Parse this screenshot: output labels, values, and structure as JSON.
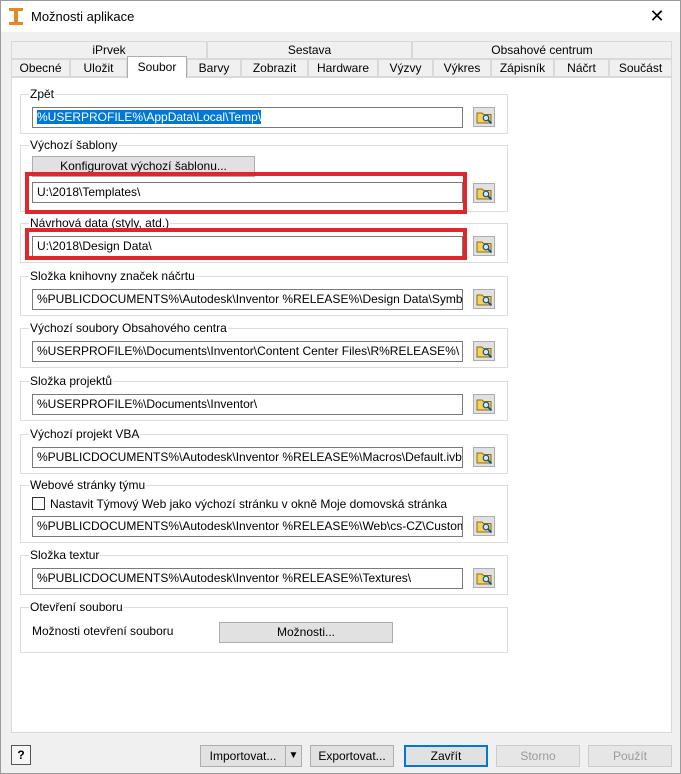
{
  "window": {
    "title": "Možnosti aplikace",
    "close": "✕"
  },
  "tabs": {
    "row1": [
      "iPrvek",
      "Sestava",
      "Obsahové centrum"
    ],
    "row2": [
      "Obecné",
      "Uložit",
      "Soubor",
      "Barvy",
      "Zobrazit",
      "Hardware",
      "Výzvy",
      "Výkres",
      "Zápisník",
      "Náčrt",
      "Součást"
    ],
    "active": "Soubor"
  },
  "groups": {
    "undo": {
      "label": "Zpět",
      "path": "%USERPROFILE%\\AppData\\Local\\Temp\\"
    },
    "templates": {
      "label": "Výchozí šablony",
      "config_button": "Konfigurovat výchozí šablonu...",
      "path": "U:\\2018\\Templates\\"
    },
    "design_data": {
      "label": "Návrhová data (styly, atd.)",
      "path": "U:\\2018\\Design Data\\"
    },
    "sketch_symbols": {
      "label": "Složka knihovny značek náčrtu",
      "path": "%PUBLICDOCUMENTS%\\Autodesk\\Inventor %RELEASE%\\Design Data\\Symbol Library\\"
    },
    "content_center": {
      "label": "Výchozí soubory Obsahového centra",
      "path": "%USERPROFILE%\\Documents\\Inventor\\Content Center Files\\R%RELEASE%\\"
    },
    "projects": {
      "label": "Složka projektů",
      "path": "%USERPROFILE%\\Documents\\Inventor\\"
    },
    "vba": {
      "label": "Výchozí projekt VBA",
      "path": "%PUBLICDOCUMENTS%\\Autodesk\\Inventor %RELEASE%\\Macros\\Default.ivb"
    },
    "team_web": {
      "label": "Webové stránky týmu",
      "checkbox_label": "Nastavit Týmový Web jako výchozí stránku v okně Moje domovská stránka",
      "checked": false,
      "path": "%PUBLICDOCUMENTS%\\Autodesk\\Inventor %RELEASE%\\Web\\cs-CZ\\CustomHelpSamples\\"
    },
    "textures": {
      "label": "Složka textur",
      "path": "%PUBLICDOCUMENTS%\\Autodesk\\Inventor %RELEASE%\\Textures\\"
    },
    "file_open": {
      "label": "Otevření souboru",
      "text": "Možnosti otevření souboru",
      "button": "Možnosti..."
    }
  },
  "footer": {
    "help": "?",
    "import": "Importovat...",
    "import_arrow": "▼",
    "export": "Exportovat...",
    "close": "Zavřít",
    "cancel": "Storno",
    "apply": "Použít"
  },
  "colors": {
    "highlight": "#e0262b",
    "selection": "#0078d7"
  },
  "icons": {
    "browse": "folder-browse-icon",
    "app": "inventor-app-icon",
    "help": "help-icon"
  }
}
